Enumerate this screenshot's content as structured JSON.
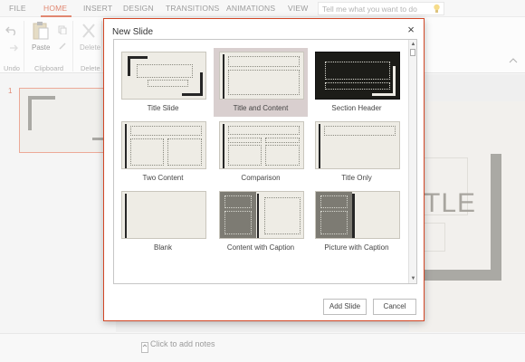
{
  "ribbon": {
    "tabs": [
      "FILE",
      "HOME",
      "INSERT",
      "DESIGN",
      "TRANSITIONS",
      "ANIMATIONS",
      "VIEW"
    ],
    "active_tab": "HOME",
    "tell_me_placeholder": "Tell me what you want to do",
    "paste_label": "Paste",
    "delete_label": "Delete",
    "groups": [
      "Undo",
      "Clipboard",
      "Delete"
    ]
  },
  "slide_pane": {
    "slide_number": "1"
  },
  "editor": {
    "title_fragment": "TLE",
    "notes_placeholder": "Click to add notes"
  },
  "dialog": {
    "title": "New Slide",
    "close_glyph": "×",
    "layouts": [
      "Title Slide",
      "Title and Content",
      "Section Header",
      "Two Content",
      "Comparison",
      "Title Only",
      "Blank",
      "Content with Caption",
      "Picture with Caption"
    ],
    "selected_layout": "Title and Content",
    "add_button": "Add Slide",
    "cancel_button": "Cancel"
  },
  "colors": {
    "accent": "#d24726",
    "selected_bg": "#d9cfcf"
  }
}
